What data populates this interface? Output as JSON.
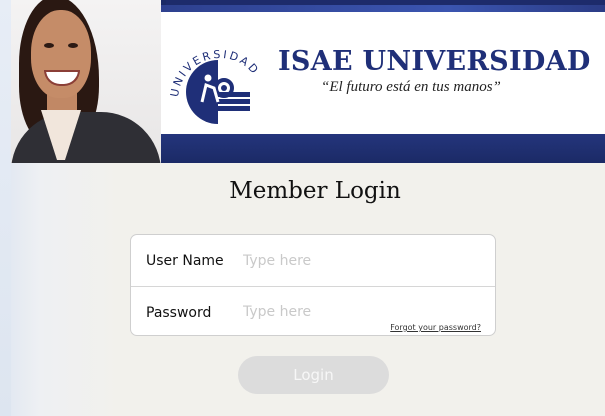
{
  "header": {
    "logo_ring_text": "UNIVERSIDAD",
    "brand_title": "ISAE UNIVERSIDAD",
    "brand_tagline": "“El futuro está en tus manos”"
  },
  "login": {
    "title": "Member Login",
    "username_label": "User Name",
    "username_placeholder": "Type here",
    "password_label": "Password",
    "password_placeholder": "Type here",
    "forgot_link": "Forgot your password?",
    "login_button": "Login"
  },
  "colors": {
    "brand_blue": "#1f2f78",
    "banner_navy": "#1d2b6b",
    "button_disabled": "#dcdcdc"
  }
}
